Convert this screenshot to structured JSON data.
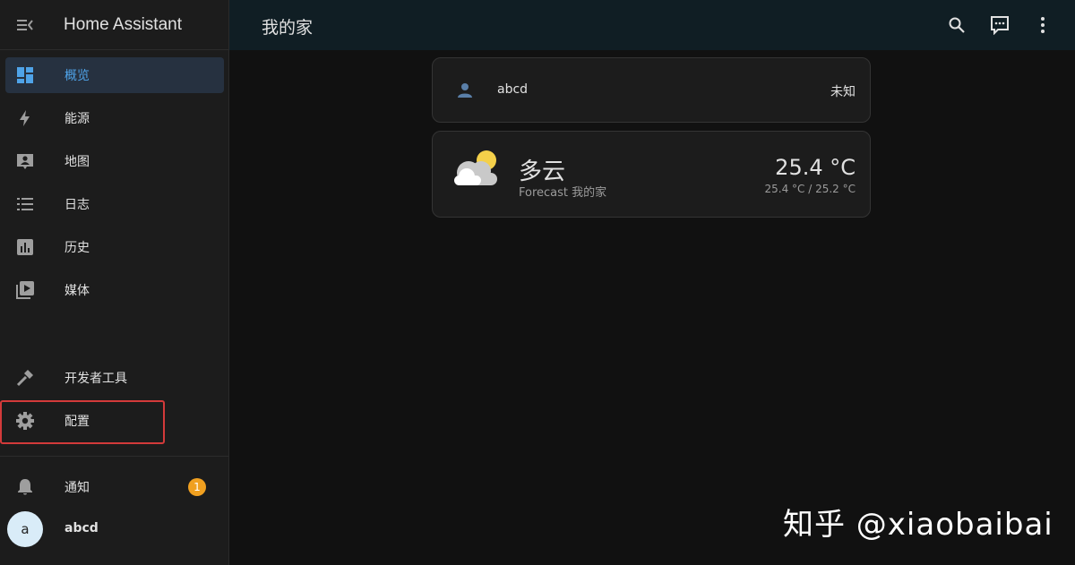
{
  "app": {
    "title": "Home Assistant"
  },
  "sidebar": {
    "items": [
      {
        "label": "概览",
        "icon": "dashboard-icon",
        "active": true
      },
      {
        "label": "能源",
        "icon": "lightning-bolt-icon"
      },
      {
        "label": "地图",
        "icon": "map-account-icon"
      },
      {
        "label": "日志",
        "icon": "logbook-list-icon"
      },
      {
        "label": "历史",
        "icon": "history-chart-icon"
      },
      {
        "label": "媒体",
        "icon": "media-play-icon"
      }
    ],
    "dev_tools": {
      "label": "开发者工具",
      "icon": "hammer-icon"
    },
    "config": {
      "label": "配置",
      "icon": "gear-icon"
    },
    "notifications": {
      "label": "通知",
      "icon": "bell-icon",
      "count": "1"
    },
    "user": {
      "initial": "a",
      "name": "abcd"
    }
  },
  "header": {
    "title": "我的家"
  },
  "cards": {
    "entity": {
      "name": "abcd",
      "state": "未知",
      "icon": "account-icon"
    },
    "weather": {
      "condition": "多云",
      "forecast_label": "Forecast 我的家",
      "temperature": "25.4 °C",
      "range": "25.4 °C / 25.2 °C",
      "icon": "partly-cloudy-icon"
    }
  },
  "watermark": "知乎 @xiaobaibai",
  "colors": {
    "accent": "#4fa3e8",
    "badge": "#f0a020",
    "highlight": "#d33a3a"
  }
}
